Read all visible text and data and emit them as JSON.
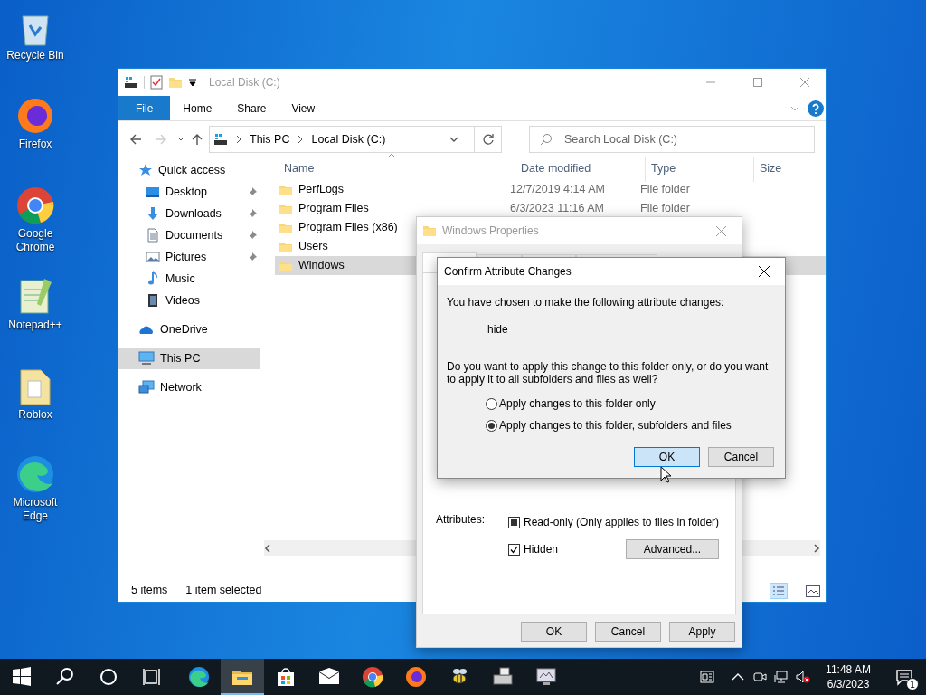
{
  "desktop_icons": [
    {
      "label": "Recycle Bin",
      "kind": "bin"
    },
    {
      "label": "Firefox",
      "kind": "firefox"
    },
    {
      "label": "Google Chrome",
      "kind": "chrome"
    },
    {
      "label": "Notepad++",
      "kind": "notepad"
    },
    {
      "label": "Roblox",
      "kind": "file"
    },
    {
      "label": "Microsoft Edge",
      "kind": "edge"
    }
  ],
  "explorer": {
    "title": "Local Disk (C:)",
    "ribbon_tabs": [
      {
        "label": "File",
        "kind": "menu"
      },
      {
        "label": "Home",
        "kind": "tab"
      },
      {
        "label": "Share",
        "kind": "tab"
      },
      {
        "label": "View",
        "kind": "tab"
      }
    ],
    "breadcrumb": [
      "This PC",
      "Local Disk (C:)"
    ],
    "search": {
      "placeholder": "Search Local Disk (C:)"
    },
    "nav": [
      {
        "label": "Quick access",
        "kind": "star",
        "section": true,
        "pinned": false,
        "selected": false
      },
      {
        "label": "Desktop",
        "kind": "desktop",
        "section": false,
        "pinned": true,
        "selected": false
      },
      {
        "label": "Downloads",
        "kind": "downloads",
        "section": false,
        "pinned": true,
        "selected": false
      },
      {
        "label": "Documents",
        "kind": "documents",
        "section": false,
        "pinned": true,
        "selected": false
      },
      {
        "label": "Pictures",
        "kind": "pictures",
        "section": false,
        "pinned": true,
        "selected": false
      },
      {
        "label": "Music",
        "kind": "music",
        "section": false,
        "pinned": false,
        "selected": false
      },
      {
        "label": "Videos",
        "kind": "videos",
        "section": false,
        "pinned": false,
        "selected": false
      },
      {
        "label": "OneDrive",
        "kind": "cloud",
        "section": true,
        "pinned": false,
        "selected": false
      },
      {
        "label": "This PC",
        "kind": "pc",
        "section": true,
        "pinned": false,
        "selected": true
      },
      {
        "label": "Network",
        "kind": "network",
        "section": true,
        "pinned": false,
        "selected": false
      }
    ],
    "columns": [
      "Name",
      "Date modified",
      "Type",
      "Size"
    ],
    "rows": [
      {
        "name": "PerfLogs",
        "date": "12/7/2019 4:14 AM",
        "type": "File folder",
        "selected": false
      },
      {
        "name": "Program Files",
        "date": "6/3/2023 11:16 AM",
        "type": "File folder",
        "selected": false
      },
      {
        "name": "Program Files (x86)",
        "selected": false
      },
      {
        "name": "Users",
        "selected": false
      },
      {
        "name": "Windows",
        "selected": true
      }
    ],
    "status": {
      "count": "5 items",
      "selection": "1 item selected"
    }
  },
  "properties": {
    "title": "Windows Properties",
    "tabs": [
      {
        "selected": true
      },
      {
        "selected": false
      },
      {
        "selected": false
      },
      {
        "selected": false
      }
    ],
    "attributes_label": "Attributes:",
    "attributes": [
      {
        "label": "Read-only (Only applies to files in folder)",
        "indeterminate": true
      },
      {
        "label": "Hidden",
        "checked": true
      }
    ],
    "advanced_button": "Advanced...",
    "buttons": [
      "OK",
      "Cancel",
      "Apply"
    ]
  },
  "confirm": {
    "title": "Confirm Attribute Changes",
    "message": "You have chosen to make the following attribute changes:",
    "change": "hide",
    "question": "Do you want to apply this change to this folder only, or do you want to apply it to all subfolders and files as well?",
    "options": [
      {
        "label": "Apply changes to this folder only",
        "selected": false
      },
      {
        "label": "Apply changes to this folder, subfolders and files",
        "selected": true
      }
    ],
    "buttons": [
      {
        "label": "OK",
        "default": true
      },
      {
        "label": "Cancel",
        "default": false
      }
    ]
  },
  "taskbar": {
    "apps": [
      {
        "kind": "edge",
        "active": false
      },
      {
        "kind": "explorer",
        "active": true
      },
      {
        "kind": "store",
        "active": false
      },
      {
        "kind": "mail",
        "active": false
      },
      {
        "kind": "chrome",
        "active": false
      },
      {
        "kind": "firefox",
        "active": false
      },
      {
        "kind": "bee",
        "active": false
      },
      {
        "kind": "app",
        "active": false
      },
      {
        "kind": "monitor",
        "active": false
      }
    ],
    "time": "11:48 AM",
    "date": "6/3/2023",
    "notifications": "1"
  }
}
